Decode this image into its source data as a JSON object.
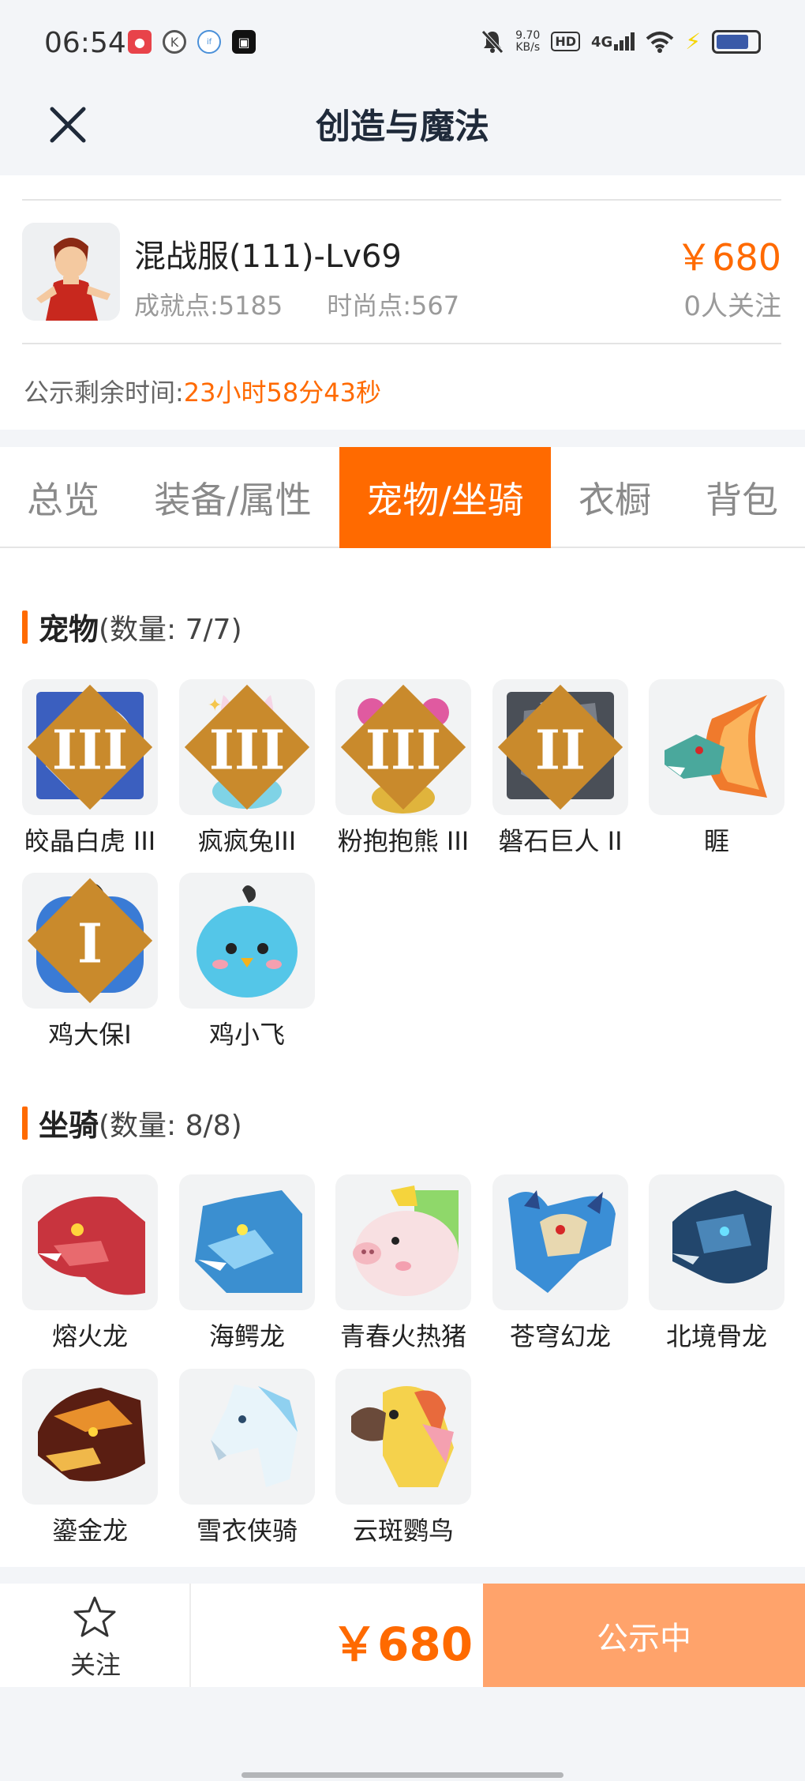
{
  "status_bar": {
    "time": "06:54",
    "net_speed_value": "9.70",
    "net_speed_unit": "KB/s",
    "hd": "HD",
    "network": "4G",
    "battery_level": 0.8
  },
  "header": {
    "title": "创造与魔法"
  },
  "product": {
    "name": "混战服(111)-Lv69",
    "achievement": "成就点:5185",
    "fashion": "时尚点:567",
    "price": "￥680",
    "followers": "0人关注",
    "timer_label": "公示剩余时间:",
    "timer_value": "23小时58分43秒"
  },
  "tabs": [
    {
      "label": "总览"
    },
    {
      "label": "装备/属性"
    },
    {
      "label": "宠物/坐骑"
    },
    {
      "label": "衣橱"
    },
    {
      "label": "背包"
    }
  ],
  "active_tab": 2,
  "pets": {
    "title": "宠物",
    "count": "(数量: 7/7)",
    "items": [
      {
        "name": "皎晶白虎 III",
        "icon": "white-tiger",
        "badge": "III"
      },
      {
        "name": "疯疯兔III",
        "icon": "crazy-rabbit",
        "badge": "III"
      },
      {
        "name": "粉抱抱熊 III",
        "icon": "pink-bear",
        "badge": "III"
      },
      {
        "name": "磐石巨人 II",
        "icon": "rock-giant",
        "badge": "II"
      },
      {
        "name": "睚",
        "icon": "fire-beast",
        "badge": ""
      },
      {
        "name": "鸡大保I",
        "icon": "blue-chicken",
        "badge": "I"
      },
      {
        "name": "鸡小飞",
        "icon": "small-bird",
        "badge": ""
      }
    ]
  },
  "mounts": {
    "title": "坐骑",
    "count": "(数量: 8/8)",
    "items": [
      {
        "name": "熔火龙",
        "icon": "red-dragon"
      },
      {
        "name": "海鳄龙",
        "icon": "sea-dragon"
      },
      {
        "name": "青春火热猪",
        "icon": "pig"
      },
      {
        "name": "苍穹幻龙",
        "icon": "sky-dragon"
      },
      {
        "name": "北境骨龙",
        "icon": "bone-dragon"
      },
      {
        "name": "鎏金龙",
        "icon": "gold-dragon"
      },
      {
        "name": "雪衣侠骑",
        "icon": "white-horse"
      },
      {
        "name": "云斑鹦鸟",
        "icon": "parrot"
      }
    ]
  },
  "bottom_bar": {
    "follow_label": "关注",
    "price": "￥680",
    "status_label": "公示中"
  },
  "colors": {
    "accent": "#ff6a00",
    "status_button": "#ffa36b",
    "background": "#f3f5f8"
  }
}
